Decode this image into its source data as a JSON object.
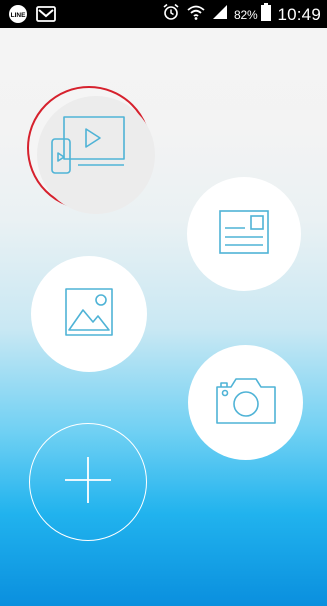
{
  "status_bar": {
    "left_icons": [
      "line-app-icon",
      "gmail-icon"
    ],
    "right_icons": [
      "alarm-clock-icon",
      "wifi-icon",
      "signal-icon",
      "battery-icon"
    ],
    "battery_percent": "82%",
    "time": "10:49"
  },
  "home": {
    "buttons": [
      {
        "id": "video",
        "icon": "video-devices-icon",
        "selected": true
      },
      {
        "id": "news",
        "icon": "newspaper-icon",
        "selected": false
      },
      {
        "id": "photo",
        "icon": "photo-gallery-icon",
        "selected": false
      },
      {
        "id": "camera",
        "icon": "camera-icon",
        "selected": false
      },
      {
        "id": "add",
        "icon": "plus-icon",
        "selected": false
      }
    ]
  },
  "colors": {
    "icon_stroke": "#4fb3d6",
    "selection_ring": "#d6212d",
    "status_bar_bg": "#000000",
    "gradient_top": "#f4f4f4",
    "gradient_bottom": "#0a8fde"
  }
}
